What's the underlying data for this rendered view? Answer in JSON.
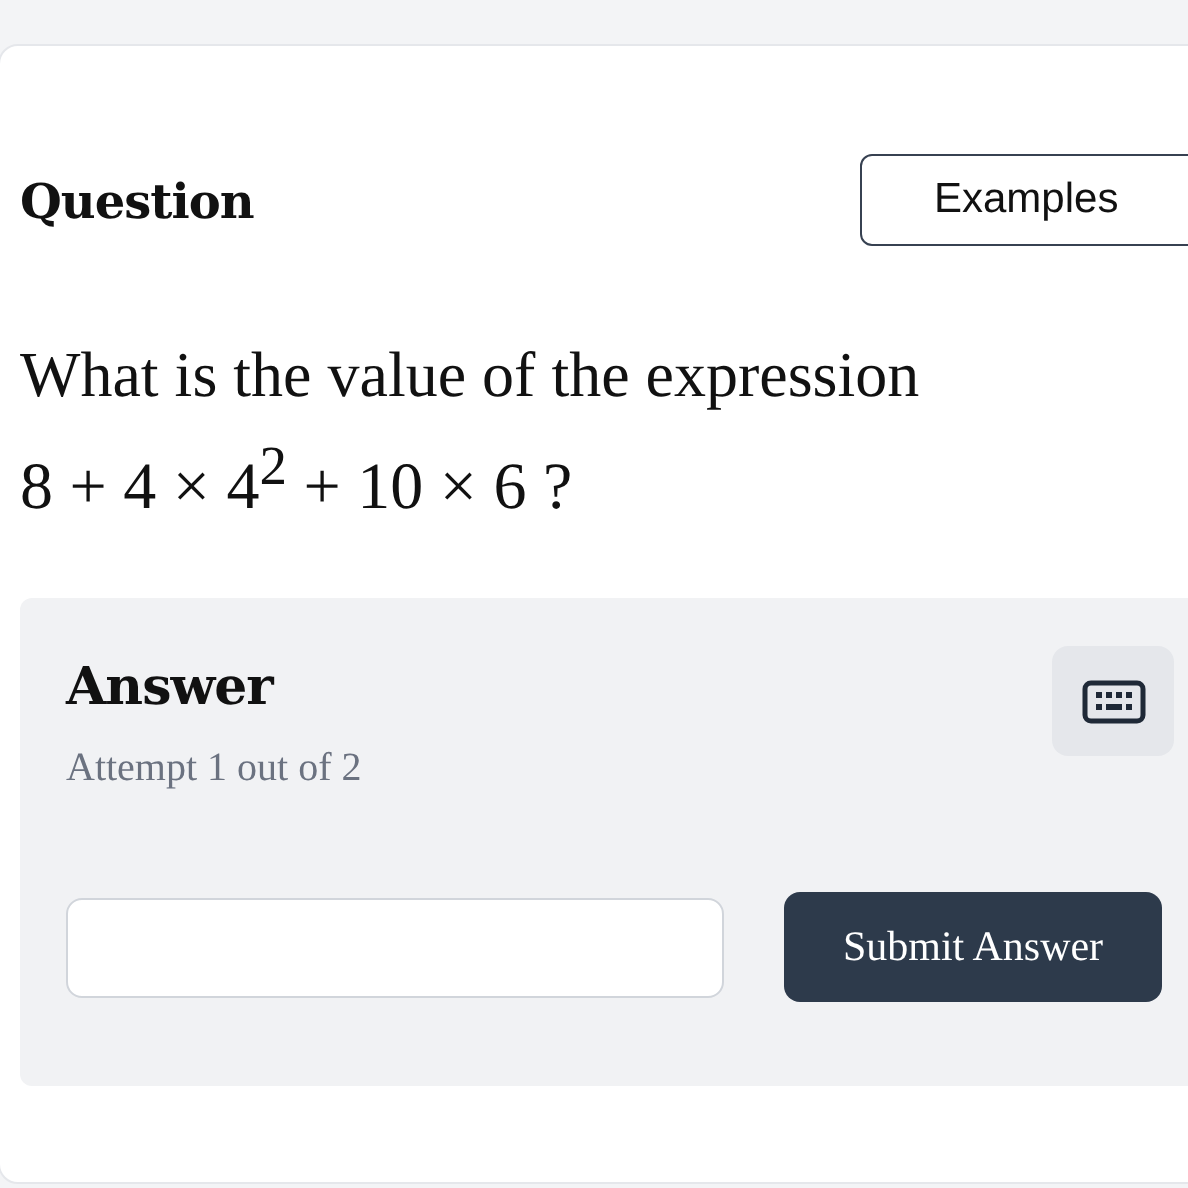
{
  "question": {
    "heading": "Question",
    "examples_button": "Examples",
    "text": "What is the value of the expression",
    "expression": "8 + 4 × 4$^{2}$ + 10 × 6 ?"
  },
  "answer": {
    "heading": "Answer",
    "attempt": "Attempt 1 out of 2",
    "submit_button": "Submit Answer"
  }
}
